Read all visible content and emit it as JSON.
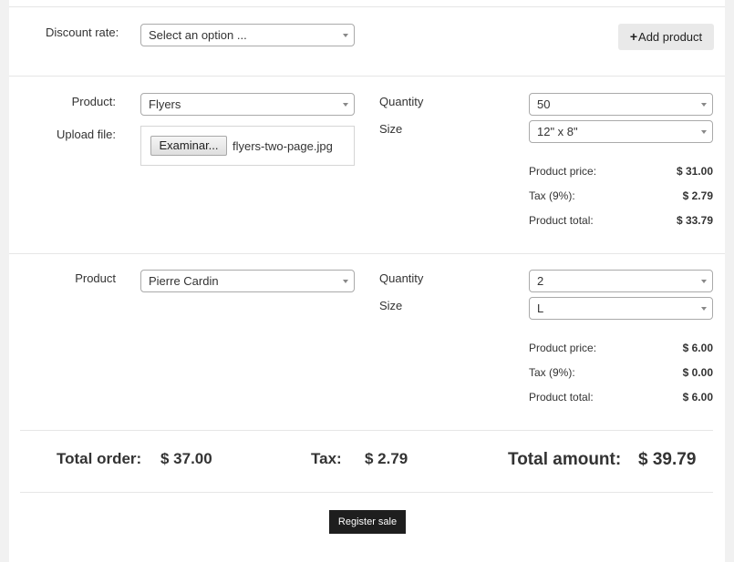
{
  "discount": {
    "label": "Discount rate:",
    "value": "Select an option ..."
  },
  "add_product_label": "Add product",
  "product1": {
    "product_label": "Product:",
    "product_value": "Flyers",
    "upload_label": "Upload file:",
    "upload_button": "Examinar...",
    "file_name": "flyers-two-page.jpg",
    "quantity_label": "Quantity",
    "quantity_value": "50",
    "size_label": "Size",
    "size_value": "12\" x 8\"",
    "price_label": "Product price:",
    "price_value": "$ 31.00",
    "tax_label": "Tax (9%):",
    "tax_value": "$ 2.79",
    "total_label": "Product total:",
    "total_value": "$ 33.79"
  },
  "product2": {
    "product_label": "Product",
    "product_value": "Pierre Cardin",
    "quantity_label": "Quantity",
    "quantity_value": "2",
    "size_label": "Size",
    "size_value": "L",
    "price_label": "Product price:",
    "price_value": "$ 6.00",
    "tax_label": "Tax (9%):",
    "tax_value": "$ 0.00",
    "total_label": "Product total:",
    "total_value": "$ 6.00"
  },
  "summary": {
    "total_order_label": "Total order:",
    "total_order_value": "$ 37.00",
    "tax_label": "Tax:",
    "tax_value": "$ 2.79",
    "total_amount_label": "Total amount:",
    "total_amount_value": "$ 39.79"
  },
  "register_label": "Register sale",
  "icons": {
    "add": "plus-icon",
    "dropdown": "chevron-down-icon"
  }
}
